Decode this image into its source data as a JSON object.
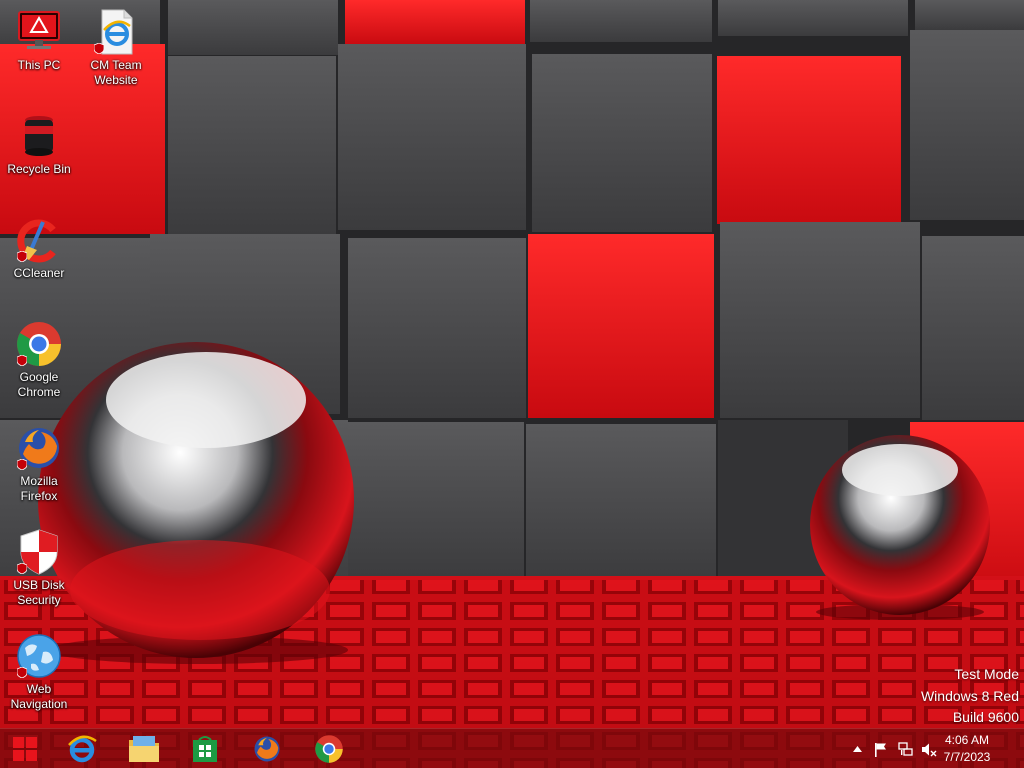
{
  "desktop_icons": [
    {
      "id": "this-pc",
      "label": "This PC",
      "icon": "computer-icon"
    },
    {
      "id": "cm-team-website",
      "label": "CM Team\nWebsite",
      "icon": "internet-explorer-file-icon"
    },
    {
      "id": "recycle-bin",
      "label": "Recycle Bin",
      "icon": "recycle-bin-icon"
    },
    {
      "id": "ccleaner",
      "label": "CCleaner",
      "icon": "ccleaner-icon"
    },
    {
      "id": "google-chrome",
      "label": "Google\nChrome",
      "icon": "chrome-icon"
    },
    {
      "id": "mozilla-firefox",
      "label": "Mozilla\nFirefox",
      "icon": "firefox-icon"
    },
    {
      "id": "usb-disk-security",
      "label": "USB Disk\nSecurity",
      "icon": "usb-disk-security-icon"
    },
    {
      "id": "web-navigation",
      "label": "Web\nNavigation",
      "icon": "globe-icon"
    }
  ],
  "watermark": {
    "line1": "Test Mode",
    "line2": "Windows 8 Red",
    "line3": "Build 9600"
  },
  "taskbar": {
    "pinned": [
      {
        "id": "start",
        "icon": "windows-start-icon"
      },
      {
        "id": "internet-explorer",
        "icon": "internet-explorer-icon"
      },
      {
        "id": "file-explorer",
        "icon": "file-explorer-icon"
      },
      {
        "id": "store",
        "icon": "windows-store-icon"
      },
      {
        "id": "firefox",
        "icon": "firefox-icon"
      },
      {
        "id": "chrome",
        "icon": "chrome-icon"
      }
    ],
    "tray_icons": [
      "show-hidden-icons-arrow",
      "action-center-flag-icon",
      "network-icon",
      "volume-muted-icon"
    ],
    "clock": {
      "time": "4:06 AM",
      "date": "7/7/2023"
    }
  },
  "colors": {
    "wallpaper_red": "#e0101a",
    "wallpaper_gray": "#4a4a4c",
    "taskbar": "#7a0a0c"
  }
}
